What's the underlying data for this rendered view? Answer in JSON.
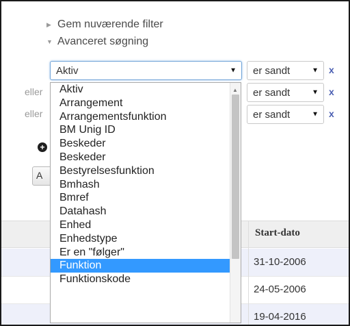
{
  "filter_links": {
    "save_filter": "Gem nuværende filter",
    "advanced_search": "Avanceret søgning"
  },
  "main_select": {
    "value": "Aktiv"
  },
  "conditions": [
    {
      "prefix": "",
      "operator": "er sandt",
      "remove": "x"
    },
    {
      "prefix": "eller",
      "operator": "er sandt",
      "remove": "x"
    },
    {
      "prefix": "eller",
      "operator": "er sandt",
      "remove": "x"
    }
  ],
  "add_icon": "+",
  "button_stub": "A",
  "table": {
    "header_start_date": "Start-dato",
    "rows": [
      "31-10-2006",
      "24-05-2006",
      "19-04-2016"
    ]
  },
  "dropdown": {
    "selected": "Funktion",
    "options": [
      "Aktiv",
      "Arrangement",
      "Arrangementsfunktion",
      "BM Unig ID",
      "Beskeder",
      "Beskeder",
      "Bestyrelsesfunktion",
      "Bmhash",
      "Bmref",
      "Datahash",
      "Enhed",
      "Enhedstype",
      "Er en \"følger\"",
      "Funktion",
      "Funktionskode"
    ]
  },
  "colors": {
    "selected_bg": "#3399ff",
    "remove_x": "#4b5fb2",
    "focus_border": "#6fa3d8"
  }
}
